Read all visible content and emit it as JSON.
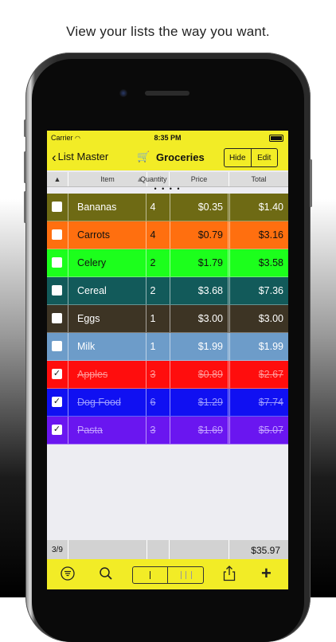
{
  "caption": "View your lists the way you want.",
  "status": {
    "carrier": "Carrier",
    "time": "8:35 PM"
  },
  "nav": {
    "back_label": "List Master",
    "title": "Groceries",
    "hide_label": "Hide",
    "edit_label": "Edit"
  },
  "columns": {
    "item": "Item",
    "quantity": "Quantity",
    "price": "Price",
    "total": "Total"
  },
  "page_dots": "• • • •",
  "rows": [
    {
      "name": "Bananas",
      "qty": "4",
      "price": "$0.35",
      "total": "$1.40",
      "checked": false,
      "color": "#6e6a14"
    },
    {
      "name": "Carrots",
      "qty": "4",
      "price": "$0.79",
      "total": "$3.16",
      "checked": false,
      "color": "#ff6f0f",
      "text_color": "#111111"
    },
    {
      "name": "Celery",
      "qty": "2",
      "price": "$1.79",
      "total": "$3.58",
      "checked": false,
      "color": "#1cff1c",
      "text_color": "#111111"
    },
    {
      "name": "Cereal",
      "qty": "2",
      "price": "$3.68",
      "total": "$7.36",
      "checked": false,
      "color": "#125a5a"
    },
    {
      "name": "Eggs",
      "qty": "1",
      "price": "$3.00",
      "total": "$3.00",
      "checked": false,
      "color": "#3d3424"
    },
    {
      "name": "Milk",
      "qty": "1",
      "price": "$1.99",
      "total": "$1.99",
      "checked": false,
      "color": "#6d9cc9"
    },
    {
      "name": "Apples",
      "qty": "3",
      "price": "$0.89",
      "total": "$2.67",
      "checked": true,
      "color": "#ff0d0d"
    },
    {
      "name": "Dog Food",
      "qty": "6",
      "price": "$1.29",
      "total": "$7.74",
      "checked": true,
      "color": "#1010f2"
    },
    {
      "name": "Pasta",
      "qty": "3",
      "price": "$1.69",
      "total": "$5.07",
      "checked": true,
      "color": "#6a16f0"
    }
  ],
  "footer": {
    "count": "3/9",
    "grand_total": "$35.97"
  },
  "colors": {
    "accent": "#f2ec26"
  }
}
